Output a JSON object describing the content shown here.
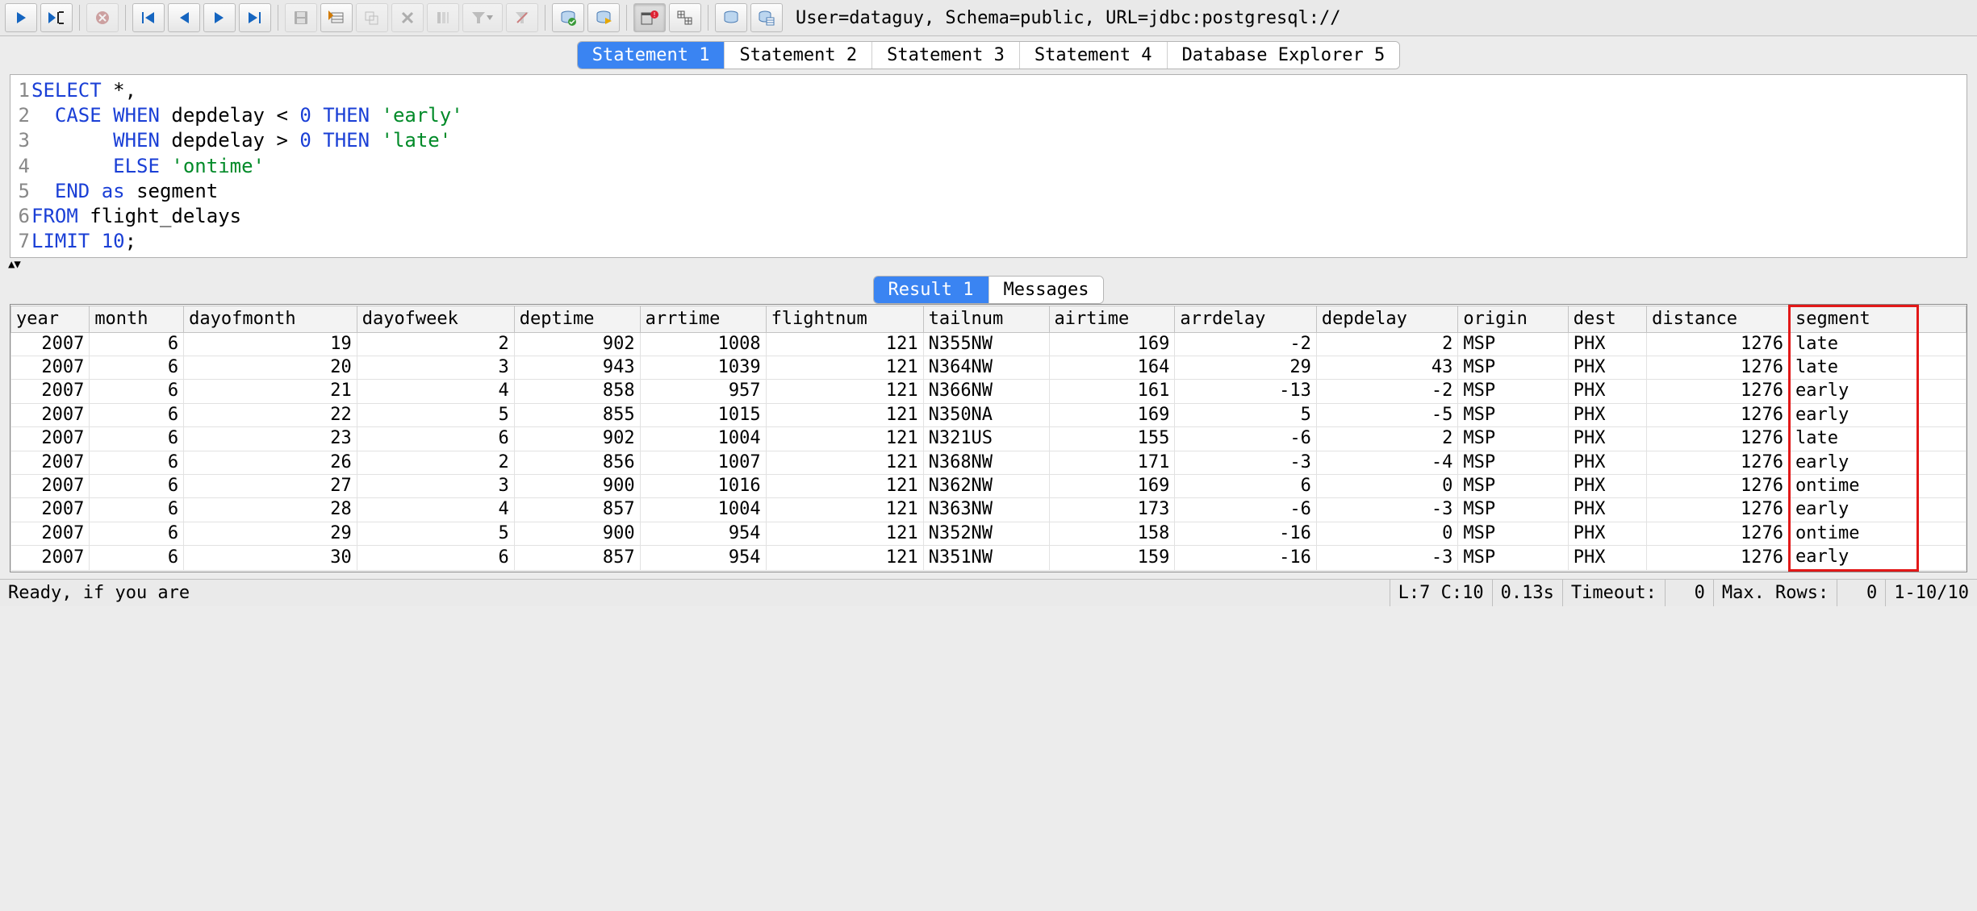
{
  "toolbar": {
    "connection_info": "User=dataguy, Schema=public, URL=jdbc:postgresql://",
    "icons": {
      "run": "run-icon",
      "run_cursor": "run-cursor-icon",
      "stop": "stop-icon",
      "first": "first-icon",
      "prev": "prev-icon",
      "next": "next-icon",
      "last": "last-icon",
      "save": "save-icon",
      "insert_row": "insert-row-icon",
      "copy_row": "copy-row-icon",
      "delete_row": "delete-row-icon",
      "filter_cols": "filter-cols-icon",
      "filter": "filter-dropdown-icon",
      "clear_filter": "clear-filter-icon",
      "db_ok": "db-ok-icon",
      "db_run": "db-run-icon",
      "commit": "commit-icon",
      "grid": "grid-icon",
      "db": "db-icon",
      "db_table": "db-table-icon"
    }
  },
  "tabs": {
    "items": [
      {
        "label": "Statement 1",
        "active": true
      },
      {
        "label": "Statement 2",
        "active": false
      },
      {
        "label": "Statement 3",
        "active": false
      },
      {
        "label": "Statement 4",
        "active": false
      },
      {
        "label": "Database Explorer 5",
        "active": false
      }
    ]
  },
  "editor": {
    "lines": [
      {
        "n": "1",
        "tokens": [
          {
            "t": "SELECT",
            "c": "kw"
          },
          {
            "t": " *,",
            "c": ""
          }
        ]
      },
      {
        "n": "2",
        "tokens": [
          {
            "t": "  ",
            "c": ""
          },
          {
            "t": "CASE",
            "c": "kw"
          },
          {
            "t": " ",
            "c": ""
          },
          {
            "t": "WHEN",
            "c": "kw"
          },
          {
            "t": " depdelay < ",
            "c": ""
          },
          {
            "t": "0",
            "c": "num"
          },
          {
            "t": " ",
            "c": ""
          },
          {
            "t": "THEN",
            "c": "kw"
          },
          {
            "t": " ",
            "c": ""
          },
          {
            "t": "'early'",
            "c": "str"
          }
        ]
      },
      {
        "n": "3",
        "tokens": [
          {
            "t": "       ",
            "c": ""
          },
          {
            "t": "WHEN",
            "c": "kw"
          },
          {
            "t": " depdelay > ",
            "c": ""
          },
          {
            "t": "0",
            "c": "num"
          },
          {
            "t": " ",
            "c": ""
          },
          {
            "t": "THEN",
            "c": "kw"
          },
          {
            "t": " ",
            "c": ""
          },
          {
            "t": "'late'",
            "c": "str"
          }
        ]
      },
      {
        "n": "4",
        "tokens": [
          {
            "t": "       ",
            "c": ""
          },
          {
            "t": "ELSE",
            "c": "kw"
          },
          {
            "t": " ",
            "c": ""
          },
          {
            "t": "'ontime'",
            "c": "str"
          }
        ]
      },
      {
        "n": "5",
        "tokens": [
          {
            "t": "  ",
            "c": ""
          },
          {
            "t": "END",
            "c": "kw"
          },
          {
            "t": " ",
            "c": ""
          },
          {
            "t": "as",
            "c": "kw"
          },
          {
            "t": " segment",
            "c": ""
          }
        ]
      },
      {
        "n": "6",
        "tokens": [
          {
            "t": "FROM",
            "c": "kw"
          },
          {
            "t": " flight_delays",
            "c": ""
          }
        ]
      },
      {
        "n": "7",
        "tokens": [
          {
            "t": "LIMIT",
            "c": "kw"
          },
          {
            "t": " ",
            "c": ""
          },
          {
            "t": "10",
            "c": "num"
          },
          {
            "t": ";",
            "c": ""
          }
        ]
      }
    ]
  },
  "result_tabs": {
    "items": [
      {
        "label": "Result 1",
        "active": true
      },
      {
        "label": "Messages",
        "active": false
      }
    ]
  },
  "result": {
    "columns": [
      "year",
      "month",
      "dayofmonth",
      "dayofweek",
      "deptime",
      "arrtime",
      "flightnum",
      "tailnum",
      "airtime",
      "arrdelay",
      "depdelay",
      "origin",
      "dest",
      "distance",
      "segment"
    ],
    "numeric_cols": [
      0,
      1,
      2,
      3,
      4,
      5,
      6,
      8,
      9,
      10,
      13
    ],
    "rows": [
      [
        "2007",
        "6",
        "19",
        "2",
        "902",
        "1008",
        "121",
        "N355NW",
        "169",
        "-2",
        "2",
        "MSP",
        "PHX",
        "1276",
        "late"
      ],
      [
        "2007",
        "6",
        "20",
        "3",
        "943",
        "1039",
        "121",
        "N364NW",
        "164",
        "29",
        "43",
        "MSP",
        "PHX",
        "1276",
        "late"
      ],
      [
        "2007",
        "6",
        "21",
        "4",
        "858",
        "957",
        "121",
        "N366NW",
        "161",
        "-13",
        "-2",
        "MSP",
        "PHX",
        "1276",
        "early"
      ],
      [
        "2007",
        "6",
        "22",
        "5",
        "855",
        "1015",
        "121",
        "N350NA",
        "169",
        "5",
        "-5",
        "MSP",
        "PHX",
        "1276",
        "early"
      ],
      [
        "2007",
        "6",
        "23",
        "6",
        "902",
        "1004",
        "121",
        "N321US",
        "155",
        "-6",
        "2",
        "MSP",
        "PHX",
        "1276",
        "late"
      ],
      [
        "2007",
        "6",
        "26",
        "2",
        "856",
        "1007",
        "121",
        "N368NW",
        "171",
        "-3",
        "-4",
        "MSP",
        "PHX",
        "1276",
        "early"
      ],
      [
        "2007",
        "6",
        "27",
        "3",
        "900",
        "1016",
        "121",
        "N362NW",
        "169",
        "6",
        "0",
        "MSP",
        "PHX",
        "1276",
        "ontime"
      ],
      [
        "2007",
        "6",
        "28",
        "4",
        "857",
        "1004",
        "121",
        "N363NW",
        "173",
        "-6",
        "-3",
        "MSP",
        "PHX",
        "1276",
        "early"
      ],
      [
        "2007",
        "6",
        "29",
        "5",
        "900",
        "954",
        "121",
        "N352NW",
        "158",
        "-16",
        "0",
        "MSP",
        "PHX",
        "1276",
        "ontime"
      ],
      [
        "2007",
        "6",
        "30",
        "6",
        "857",
        "954",
        "121",
        "N351NW",
        "159",
        "-16",
        "-3",
        "MSP",
        "PHX",
        "1276",
        "early"
      ]
    ],
    "highlight_col": 14
  },
  "statusbar": {
    "ready": "Ready, if you are",
    "cursor": "L:7 C:10",
    "elapsed": "0.13s",
    "timeout_label": "Timeout:",
    "timeout_value": "0",
    "maxrows_label": "Max. Rows:",
    "maxrows_value": "0",
    "range": "1-10/10"
  }
}
